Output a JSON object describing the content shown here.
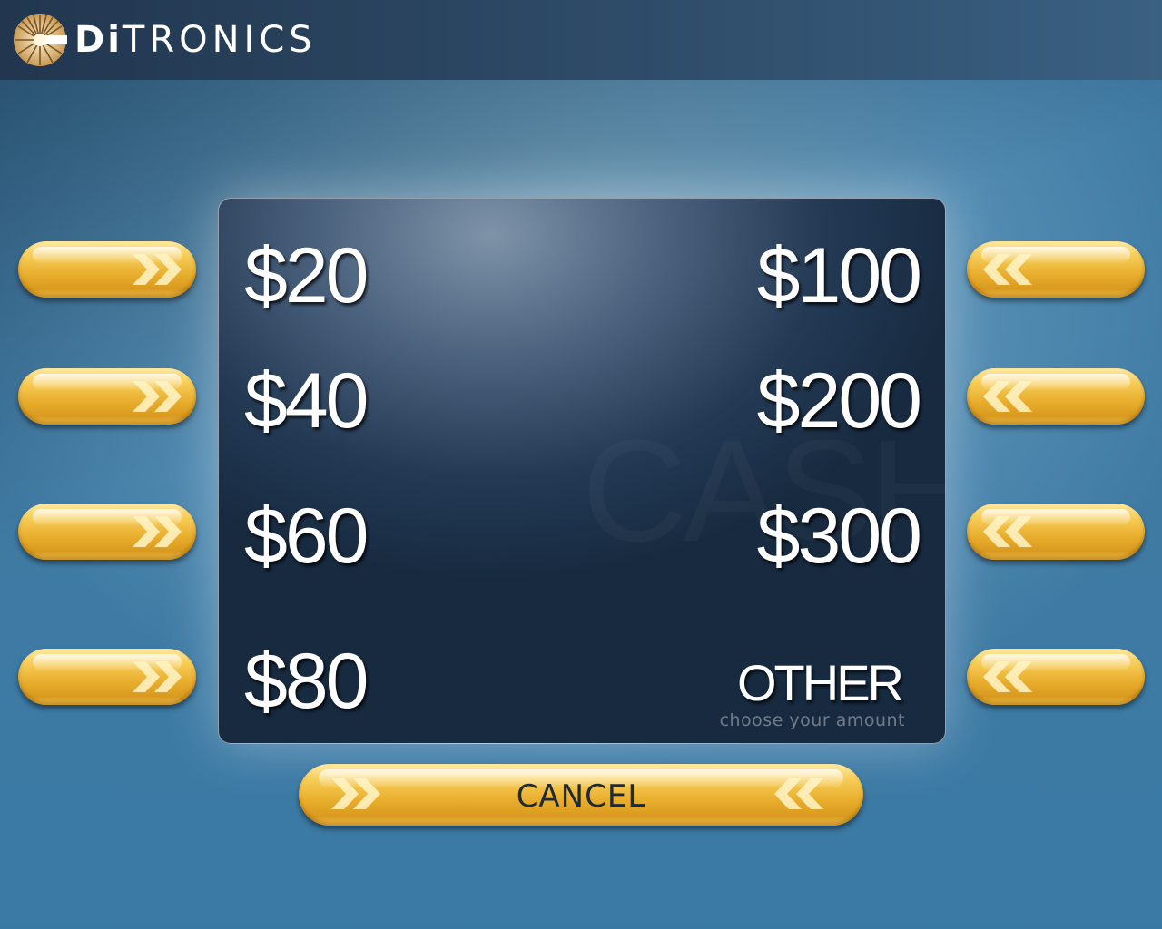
{
  "brand": {
    "name_bold": "Di",
    "name_rest": "TRONICS",
    "logo_icon": "sunburst-logo-icon",
    "colors": {
      "header": "#2d4a66",
      "button_gold": "#e8ad2c",
      "screen": "#172a40"
    }
  },
  "screen": {
    "watermark": "CASH",
    "left_amounts": [
      "$20",
      "$40",
      "$60",
      "$80"
    ],
    "right_amounts": [
      "$100",
      "$200",
      "$300"
    ],
    "other": {
      "label": "OTHER",
      "sublabel": "choose your amount"
    }
  },
  "side_buttons": {
    "left_icon": "double-chevron-right-icon",
    "right_icon": "double-chevron-left-icon"
  },
  "cancel": {
    "label": "CANCEL"
  }
}
